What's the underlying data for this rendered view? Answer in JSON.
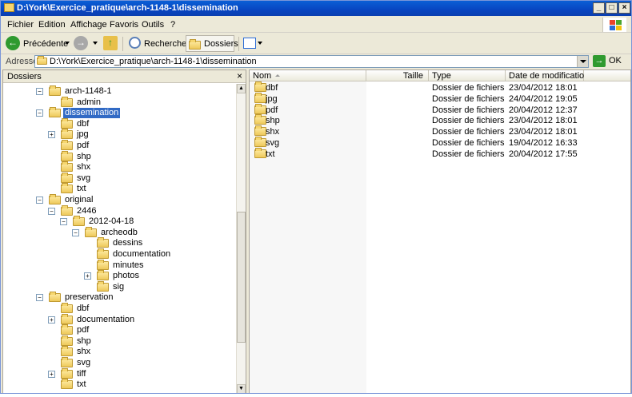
{
  "window": {
    "title": "D:\\York\\Exercice_pratique\\arch-1148-1\\dissemination"
  },
  "menu": [
    "Fichier",
    "Edition",
    "Affichage",
    "Favoris",
    "Outils",
    "?"
  ],
  "toolbar": {
    "back_label": "Précédente",
    "search_label": "Rechercher",
    "folders_label": "Dossiers"
  },
  "address": {
    "label": "Adresse",
    "value": "D:\\York\\Exercice_pratique\\arch-1148-1\\dissemination",
    "go_label": "OK"
  },
  "folders_pane": {
    "title": "Dossiers",
    "close": "×"
  },
  "tree": [
    {
      "label": "arch-1148-1",
      "expander": "−"
    },
    {
      "label": "admin"
    },
    {
      "label": "dissemination",
      "expander": "−",
      "selected": true
    },
    {
      "label": "dbf"
    },
    {
      "label": "jpg",
      "expander": "+"
    },
    {
      "label": "pdf"
    },
    {
      "label": "shp"
    },
    {
      "label": "shx"
    },
    {
      "label": "svg"
    },
    {
      "label": "txt"
    },
    {
      "label": "original",
      "expander": "−"
    },
    {
      "label": "2446",
      "expander": "−"
    },
    {
      "label": "2012-04-18",
      "expander": "−"
    },
    {
      "label": "archeodb",
      "expander": "−"
    },
    {
      "label": "dessins"
    },
    {
      "label": "documentation"
    },
    {
      "label": "minutes"
    },
    {
      "label": "photos",
      "expander": "+"
    },
    {
      "label": "sig"
    },
    {
      "label": "preservation",
      "expander": "−"
    },
    {
      "label": "dbf"
    },
    {
      "label": "documentation",
      "expander": "+"
    },
    {
      "label": "pdf"
    },
    {
      "label": "shp"
    },
    {
      "label": "shx"
    },
    {
      "label": "svg"
    },
    {
      "label": "tiff",
      "expander": "+"
    },
    {
      "label": "txt"
    }
  ],
  "columns": [
    "Nom",
    "Taille",
    "Type",
    "Date de modification"
  ],
  "files": [
    {
      "name": "dbf",
      "size": "",
      "type": "Dossier de fichiers",
      "date": "23/04/2012 18:01"
    },
    {
      "name": "jpg",
      "size": "",
      "type": "Dossier de fichiers",
      "date": "24/04/2012 19:05"
    },
    {
      "name": "pdf",
      "size": "",
      "type": "Dossier de fichiers",
      "date": "20/04/2012 12:37"
    },
    {
      "name": "shp",
      "size": "",
      "type": "Dossier de fichiers",
      "date": "23/04/2012 18:01"
    },
    {
      "name": "shx",
      "size": "",
      "type": "Dossier de fichiers",
      "date": "23/04/2012 18:01"
    },
    {
      "name": "svg",
      "size": "",
      "type": "Dossier de fichiers",
      "date": "19/04/2012 16:33"
    },
    {
      "name": "txt",
      "size": "",
      "type": "Dossier de fichiers",
      "date": "20/04/2012 17:55"
    }
  ],
  "colors": {
    "title_bar": "#0a5fd6",
    "selection": "#316ac5",
    "chrome": "#ece9d8",
    "folder": "#f6d66e"
  },
  "icons": {
    "back": "back-arrow-icon",
    "forward": "forward-arrow-icon",
    "up": "up-folder-icon",
    "search": "search-icon",
    "folders": "folders-icon",
    "views": "views-icon",
    "go": "go-arrow-icon"
  }
}
